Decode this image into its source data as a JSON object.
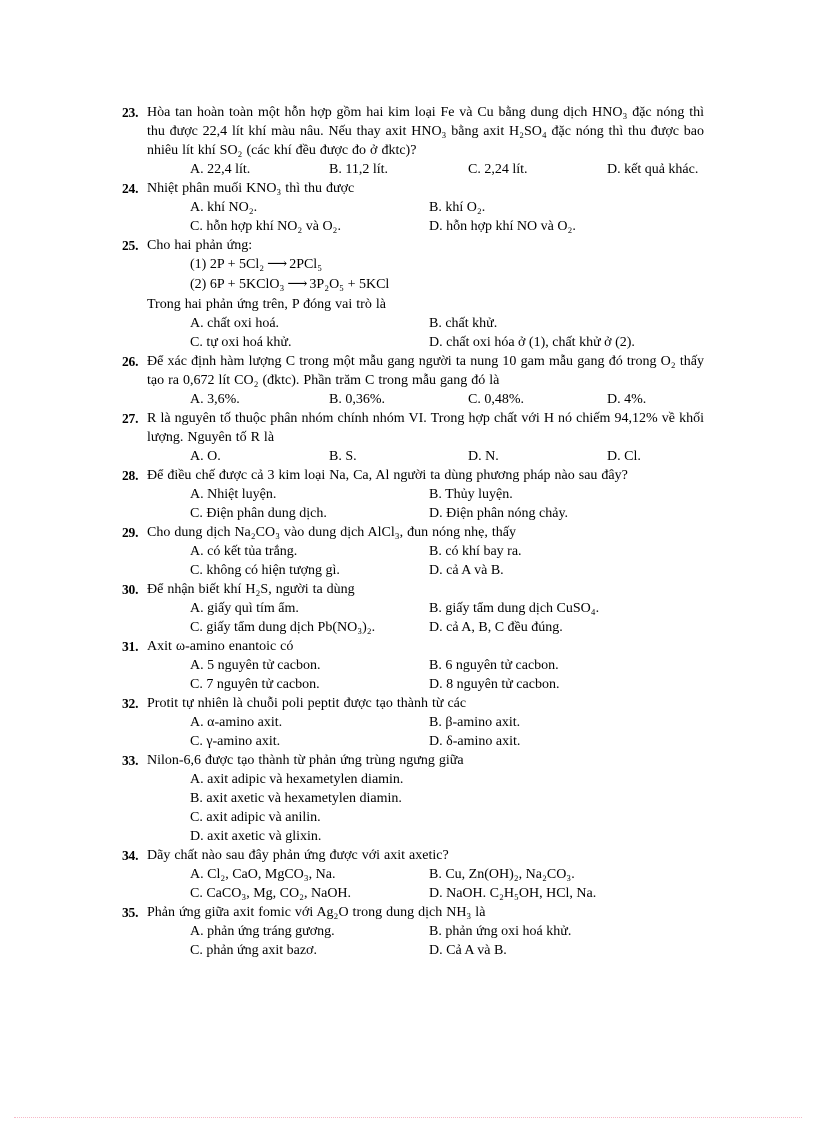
{
  "document": {
    "type": "multiple-choice-exam",
    "subject": "Hóa học",
    "language": "vi"
  },
  "questions": [
    {
      "number": "23.",
      "stem": "Hòa tan hoàn toàn một hỗn hợp gồm hai kim loại Fe và Cu bằng dung dịch HNO₃ đặc nóng thì thu được 22,4 lít khí màu nâu. Nếu thay axit HNO₃ bằng axit H₂SO₄ đặc nóng thì thu được bao nhiêu lít khí SO₂ (các khí đều được đo ở đktc)?",
      "layout": "four",
      "options": [
        "A. 22,4 lít.",
        "B. 11,2 lít.",
        "C. 2,24 lít.",
        "D. kết quả khác."
      ]
    },
    {
      "number": "24.",
      "stem": "Nhiệt phân muối KNO₃ thì thu được",
      "layout": "two",
      "options": [
        "A. khí NO₂.",
        "B. khí O₂.",
        "C. hỗn hợp khí NO₂ và O₂.",
        "D. hỗn hợp khí NO và O₂."
      ]
    },
    {
      "number": "25.",
      "stem": "Cho hai phản ứng:",
      "equations": [
        {
          "label": "(1)",
          "left": "2P + 5Cl₂",
          "arrow": "⟶",
          "right": "2PCl₅"
        },
        {
          "label": "(2)",
          "left": "6P + 5KClO₃",
          "arrow": "⟶",
          "right": "3P₂O₅ + 5KCl"
        }
      ],
      "stem2": "Trong hai phản ứng trên, P đóng vai trò là",
      "layout": "two",
      "options": [
        "A. chất oxi hoá.",
        "B. chất khử.",
        "C. tự oxi hoá khử.",
        "D. chất oxi hóa ở (1), chất khử ở (2)."
      ]
    },
    {
      "number": "26.",
      "stem": "Để xác định hàm lượng C trong một mẫu gang người ta nung 10 gam mẫu gang đó trong O₂ thấy tạo ra 0,672 lít CO₂ (đktc). Phần trăm C trong mẫu gang đó là",
      "layout": "four",
      "options": [
        "A. 3,6%.",
        "B. 0,36%.",
        "C. 0,48%.",
        "D. 4%."
      ]
    },
    {
      "number": "27.",
      "stem": "R là nguyên tố thuộc phân nhóm chính nhóm VI. Trong hợp chất với H nó chiếm 94,12% về khối lượng. Nguyên tố R là",
      "layout": "four",
      "options": [
        "A. O.",
        "B. S.",
        "D. N.",
        "D. Cl."
      ]
    },
    {
      "number": "28.",
      "stem": "Để điều chế được cả 3 kim loại Na, Ca, Al người ta dùng phương pháp nào sau đây?",
      "layout": "two",
      "options": [
        "A. Nhiệt luyện.",
        "B. Thủy luyện.",
        "C. Điện phân dung dịch.",
        "D. Điện phân nóng chảy."
      ]
    },
    {
      "number": "29.",
      "stem": "Cho dung dịch Na₂CO₃ vào dung dịch AlCl₃, đun nóng nhẹ, thấy",
      "layout": "two",
      "options": [
        "A. có kết tủa trắng.",
        "B. có khí bay ra.",
        "C. không có hiện tượng gì.",
        "D. cả A và B."
      ]
    },
    {
      "number": "30.",
      "stem": "Để nhận biết khí H₂S, người ta dùng",
      "layout": "two",
      "options": [
        "A. giấy quì tím ẩm.",
        "B. giấy tẩm dung dịch CuSO₄.",
        "C. giấy tẩm dung dịch Pb(NO₃)₂.",
        "D. cả A, B, C đều đúng."
      ]
    },
    {
      "number": "31.",
      "stem": "Axit ω-amino enantoic có",
      "layout": "two",
      "options": [
        "A. 5 nguyên tử cacbon.",
        "B. 6 nguyên tử cacbon.",
        "C. 7 nguyên tử cacbon.",
        "D. 8 nguyên tử cacbon."
      ]
    },
    {
      "number": "32.",
      "stem": "Protit tự nhiên là chuỗi poli peptit được tạo thành từ các",
      "layout": "two",
      "options": [
        "A. α-amino axit.",
        "B. β-amino axit.",
        "C. γ-amino axit.",
        "D. δ-amino axit."
      ]
    },
    {
      "number": "33.",
      "stem": "Nilon-6,6 được tạo thành từ phản ứng trùng ngưng giữa",
      "layout": "one",
      "options": [
        "A. axit adipic và hexametylen  diamin.",
        "B. axit axetic và hexametylen  diamin.",
        "C. axit adipic và anilin.",
        "D. axit axetic và glixin."
      ]
    },
    {
      "number": "34.",
      "stem": "Dãy chất nào sau đây phản ứng được với axit axetic?",
      "layout": "two",
      "options": [
        "A. Cl₂, CaO, MgCO₃, Na.",
        "B. Cu, Zn(OH)₂, Na₂CO₃.",
        "C. CaCO₃, Mg, CO₂, NaOH.",
        "D. NaOH. C₂H₅OH, HCl, Na."
      ]
    },
    {
      "number": "35.",
      "stem": "Phản ứng giữa axit fomic với Ag₂O trong dung dịch NH₃ là",
      "layout": "two",
      "options": [
        "A. phản ứng tráng gương.",
        "B. phản ứng oxi hoá khử.",
        "C. phản ứng axit bazơ.",
        "D. Cả A và B."
      ]
    }
  ],
  "footer": {
    "rule_color": "#f7b9c8"
  }
}
